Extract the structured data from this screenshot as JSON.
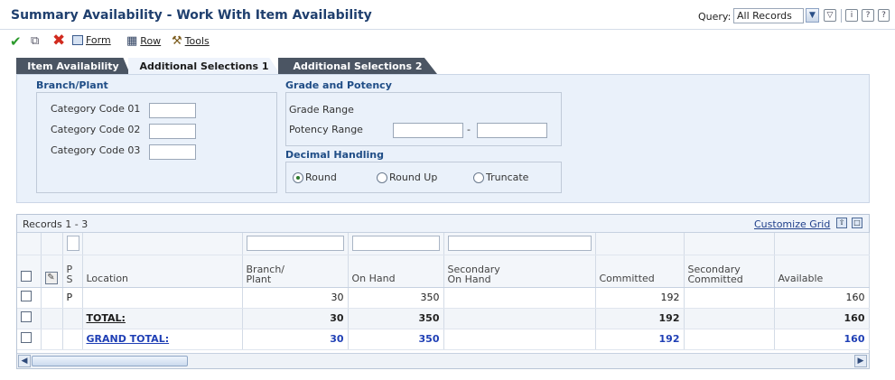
{
  "title": "Summary Availability - Work With Item Availability",
  "query": {
    "label": "Query:",
    "selected": "All Records"
  },
  "header_icons": [
    "filter-icon",
    "info-icon",
    "help-icon",
    "personalize-icon"
  ],
  "toolbar": {
    "form_label": "Form",
    "row_label": "Row",
    "tools_label": "Tools"
  },
  "tabs": [
    {
      "label": "Item Availability"
    },
    {
      "label": "Additional Selections 1"
    },
    {
      "label": "Additional Selections 2"
    }
  ],
  "branch_plant": {
    "title": "Branch/Plant",
    "fields": [
      {
        "label": "Category Code 01",
        "value": ""
      },
      {
        "label": "Category Code 02",
        "value": ""
      },
      {
        "label": "Category Code 03",
        "value": ""
      }
    ]
  },
  "grade_potency": {
    "title": "Grade and Potency",
    "grade_label": "Grade Range",
    "potency_label": "Potency Range",
    "dash": "-"
  },
  "decimal": {
    "title": "Decimal Handling",
    "options": [
      {
        "label": "Round",
        "selected": true
      },
      {
        "label": "Round Up",
        "selected": false
      },
      {
        "label": "Truncate",
        "selected": false
      }
    ]
  },
  "grid": {
    "records": "Records 1 - 3",
    "customize": "Customize Grid",
    "columns": {
      "ps_p": "P",
      "ps_s": "S",
      "location": "Location",
      "branch_1": "Branch/",
      "branch_2": "Plant",
      "on_hand": "On Hand",
      "sec_on_hand_1": "Secondary",
      "sec_on_hand_2": "On Hand",
      "committed": "Committed",
      "sec_committed_1": "Secondary",
      "sec_committed_2": "Committed",
      "available": "Available"
    },
    "rows": [
      {
        "ps": "P",
        "location": "",
        "branch": "30",
        "on_hand": "350",
        "sec_on_hand": "",
        "committed": "192",
        "sec_committed": "",
        "available": "160"
      },
      {
        "ps": "",
        "location": "TOTAL:",
        "branch": "30",
        "on_hand": "350",
        "sec_on_hand": "",
        "committed": "192",
        "sec_committed": "",
        "available": "160"
      },
      {
        "ps": "",
        "location": "GRAND TOTAL:",
        "branch": "30",
        "on_hand": "350",
        "sec_on_hand": "",
        "committed": "192",
        "sec_committed": "",
        "available": "160"
      }
    ]
  },
  "colors": {
    "title": "#1f3f6e",
    "group_title": "#1f4d86",
    "panel_bg": "#eaf1fa",
    "tab_dark": "#4b5563",
    "grand_total": "#1f3fb5",
    "ok_green": "#2c9a2c",
    "cancel_red": "#d12a1e"
  }
}
